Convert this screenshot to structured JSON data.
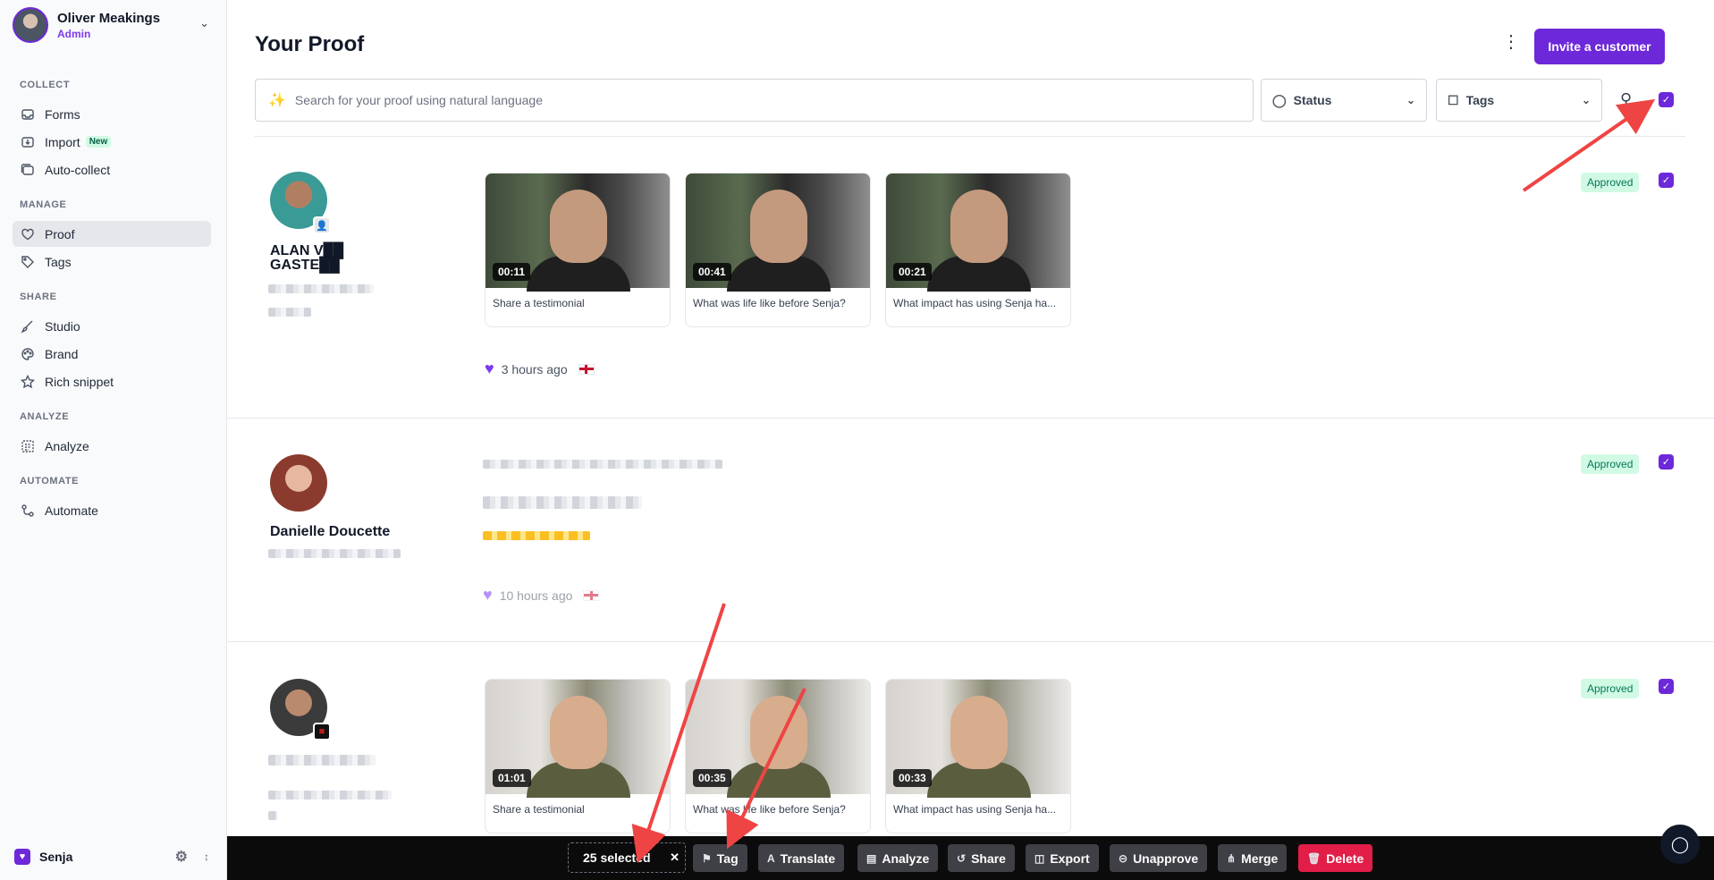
{
  "user": {
    "name": "Oliver Meakings",
    "role": "Admin"
  },
  "sidebar": {
    "sections": [
      {
        "label": "COLLECT",
        "items": [
          {
            "label": "Forms",
            "icon": "inbox-icon"
          },
          {
            "label": "Import",
            "icon": "import-icon",
            "badge": "New"
          },
          {
            "label": "Auto-collect",
            "icon": "auto-collect-icon"
          }
        ]
      },
      {
        "label": "MANAGE",
        "items": [
          {
            "label": "Proof",
            "icon": "heart-icon",
            "active": true
          },
          {
            "label": "Tags",
            "icon": "tag-icon"
          }
        ]
      },
      {
        "label": "SHARE",
        "items": [
          {
            "label": "Studio",
            "icon": "brush-icon"
          },
          {
            "label": "Brand",
            "icon": "palette-icon"
          },
          {
            "label": "Rich snippet",
            "icon": "star-icon"
          }
        ]
      },
      {
        "label": "ANALYZE",
        "items": [
          {
            "label": "Analyze",
            "icon": "analyze-icon"
          }
        ]
      },
      {
        "label": "AUTOMATE",
        "items": [
          {
            "label": "Automate",
            "icon": "automate-icon"
          }
        ]
      }
    ],
    "workspace": "Senja"
  },
  "header": {
    "title": "Your Proof",
    "invite_label": "Invite a customer",
    "search_placeholder": "Search for your proof using natural language",
    "status_filter": "Status",
    "tags_filter": "Tags"
  },
  "proofs": [
    {
      "name": "ALAN V██ GASTE██",
      "status": "Approved",
      "time": "3 hours ago",
      "videos": [
        {
          "duration": "00:11",
          "caption": "Share a testimonial"
        },
        {
          "duration": "00:41",
          "caption": "What was life like before Senja?"
        },
        {
          "duration": "00:21",
          "caption": "What impact has using Senja ha..."
        }
      ]
    },
    {
      "name": "Danielle Doucette",
      "status": "Approved",
      "time": "10 hours ago"
    },
    {
      "name": "",
      "status": "Approved",
      "videos": [
        {
          "duration": "01:01",
          "caption": "Share a testimonial"
        },
        {
          "duration": "00:35",
          "caption": "What was life like before Senja?"
        },
        {
          "duration": "00:33",
          "caption": "What impact has using Senja ha..."
        }
      ]
    }
  ],
  "action_bar": {
    "selected": "25 selected",
    "buttons": [
      "Tag",
      "Translate",
      "Analyze",
      "Share",
      "Export",
      "Unapprove",
      "Merge",
      "Delete"
    ]
  },
  "colors": {
    "accent": "#6d28d9",
    "approved_bg": "#d1fae5",
    "delete": "#e11d48",
    "annotation": "#ef4444"
  }
}
